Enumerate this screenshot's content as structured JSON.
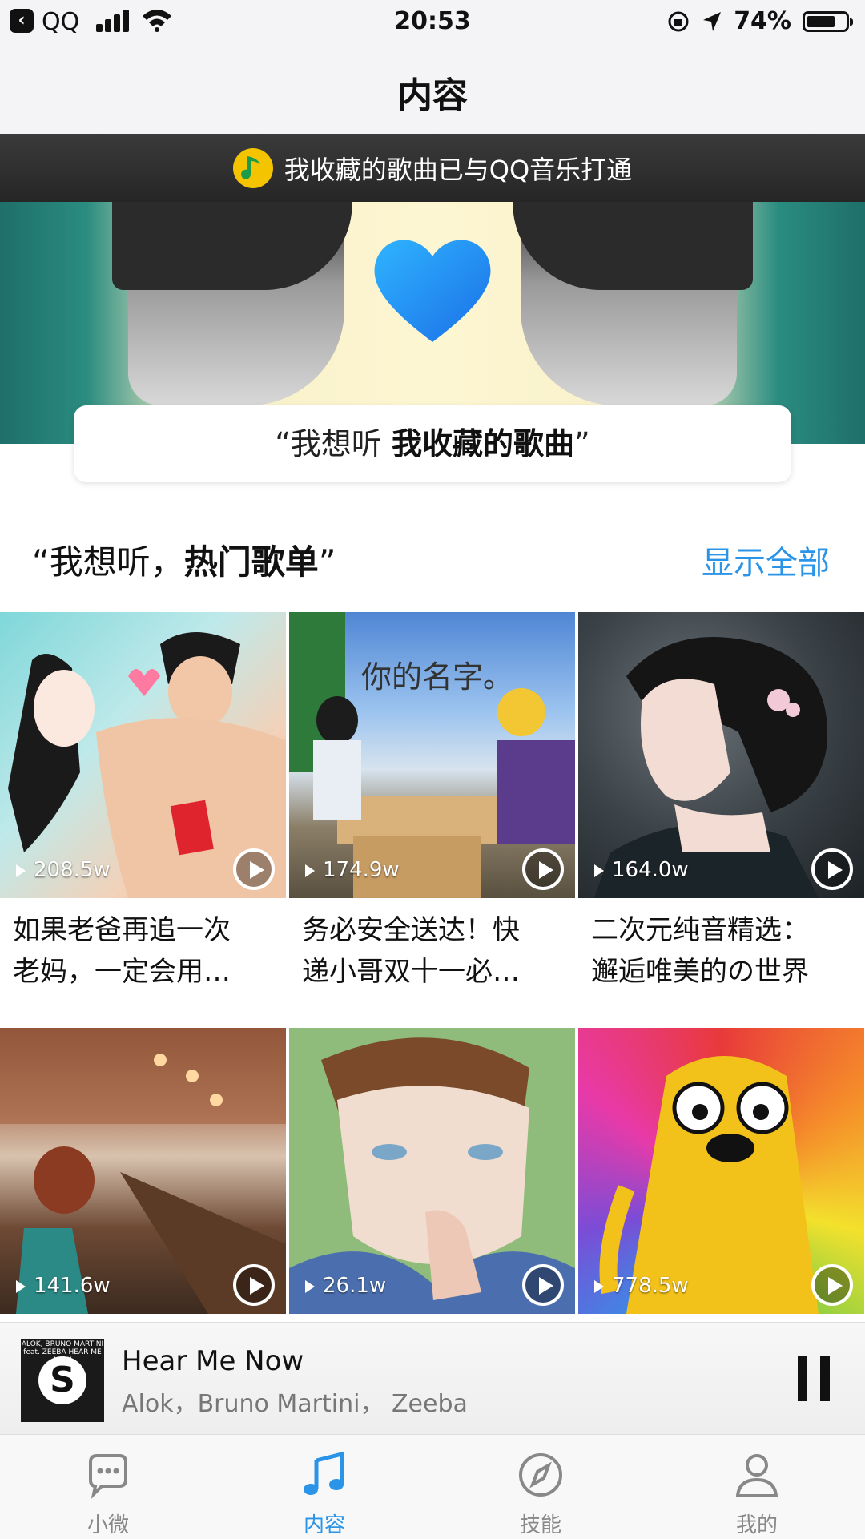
{
  "status_bar": {
    "carrier": "QQ",
    "time": "20:53",
    "battery": "74%",
    "battery_level": 0.74
  },
  "navbar": {
    "title": "内容"
  },
  "sync_banner": {
    "text": "我收藏的歌曲已与QQ音乐打通",
    "icon": "qq-music-icon"
  },
  "hero": {
    "request_prefix": "“我想听 ",
    "request_bold": "我收藏的歌曲",
    "request_suffix": "”"
  },
  "section": {
    "title_prefix": "“我想听，",
    "title_bold": "热门歌单",
    "title_suffix": "”",
    "show_all": "显示全部"
  },
  "playlists": [
    {
      "count": "208.5w",
      "name": "如果老爸再追一次\n老妈，一定会用…",
      "theme": "#7fd7d9"
    },
    {
      "count": "174.9w",
      "name": "务必安全送达！快\n递小哥双十一必…",
      "theme": "#6d9fd6",
      "cover_text": "你的名字。"
    },
    {
      "count": "164.0w",
      "name": "二次元纯音精选：\n邂逅唯美的の世界",
      "theme": "#3b4348"
    },
    {
      "count": "141.6w",
      "name": "",
      "theme": "#a06a4a"
    },
    {
      "count": "26.1w",
      "name": "",
      "theme": "#8fbc7a"
    },
    {
      "count": "778.5w",
      "name": "",
      "theme": "#f3c21a"
    }
  ],
  "mini_player": {
    "song": "Hear Me Now",
    "artist": "Alok，Bruno Martini， Zeeba",
    "art_text": "ALOK, BRUNO MARTINI feat. ZEEBA HEAR ME NOW",
    "art_logo": "S"
  },
  "tabs": [
    {
      "label": "小微",
      "icon": "chat-bubble-icon",
      "active": false
    },
    {
      "label": "内容",
      "icon": "music-note-icon",
      "active": true
    },
    {
      "label": "技能",
      "icon": "compass-icon",
      "active": false
    },
    {
      "label": "我的",
      "icon": "person-icon",
      "active": false
    }
  ],
  "colors": {
    "accent": "#2a95e8"
  }
}
